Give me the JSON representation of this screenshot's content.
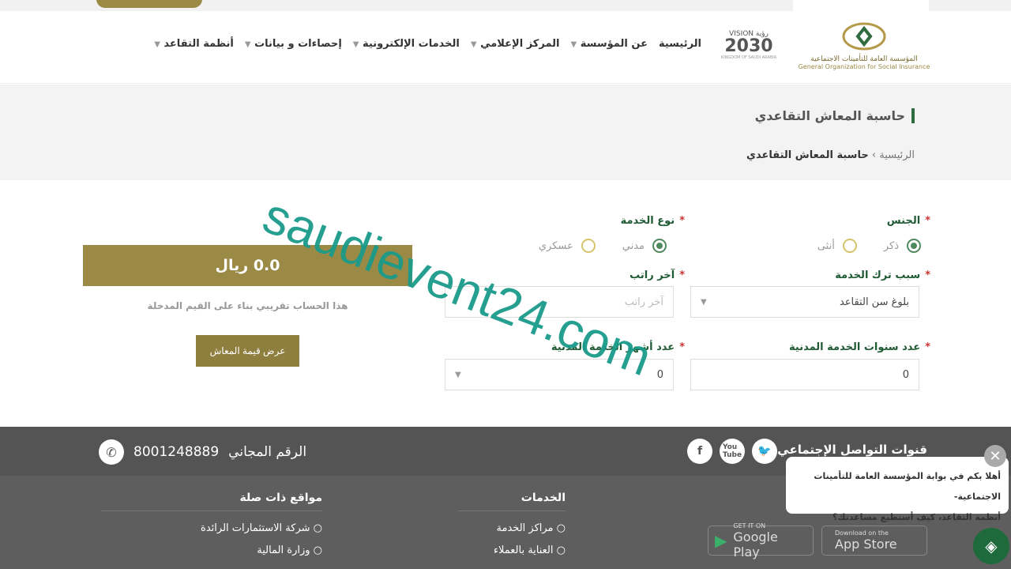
{
  "header": {
    "logo_ar": "المؤسسة العامة للتأمينات الاجتماعية",
    "logo_en": "General Organization for Social Insurance",
    "vision_label": "VISION رؤية",
    "vision_year": "2030",
    "vision_sub": "KINGDOM OF SAUDI ARABIA",
    "nav": [
      {
        "label": "الرئيسية",
        "dropdown": false
      },
      {
        "label": "عن المؤسسة",
        "dropdown": true
      },
      {
        "label": "المركز الإعلامي",
        "dropdown": true
      },
      {
        "label": "الخدمات الإلكترونية",
        "dropdown": true
      },
      {
        "label": "إحصاءات و بيانات",
        "dropdown": true
      },
      {
        "label": "أنظمة التقاعد",
        "dropdown": true
      }
    ]
  },
  "page": {
    "title": "حاسبة المعاش التقاعدي",
    "breadcrumb": [
      "الرئيسية",
      "حاسبة المعاش التقاعدي"
    ],
    "breadcrumb_sep": "›"
  },
  "form": {
    "gender": {
      "label": "الجنس",
      "options": [
        "ذكر",
        "أنثى"
      ],
      "selected": "ذكر"
    },
    "service_type": {
      "label": "نوع الخدمة",
      "options": [
        "مدني",
        "عسكري"
      ],
      "selected": "مدني"
    },
    "leave_reason": {
      "label": "سبب ترك الخدمة",
      "value": "بلوغ سن التقاعد"
    },
    "last_salary": {
      "label": "آخر راتب",
      "placeholder": "آخر راتب",
      "value": ""
    },
    "civil_years": {
      "label": "عدد سنوات الخدمة المدنية",
      "value": "0"
    },
    "civil_months": {
      "label": "عدد أشهر الخدمة المدنية",
      "value": "0"
    },
    "required_mark": "*"
  },
  "result": {
    "value": "0.0 ريال",
    "note": "هذا الحساب تقريبي بناء على القيم المدخلة",
    "button": "عرض قيمة المعاش"
  },
  "watermark": "saudievent24.com",
  "footer": {
    "social_title": "قنوات التواصل الإجتماعي",
    "social": [
      "twitter",
      "youtube",
      "facebook"
    ],
    "toll_free_label": "الرقم المجاني",
    "toll_free_number": "8001248889",
    "services_title": "الخدمات",
    "services": [
      "مراكز الخدمة",
      "العناية بالعملاء"
    ],
    "related_title": "مواقع ذات صلة",
    "related": [
      "شركة الاستثمارات الرائدة",
      "وزارة المالية"
    ],
    "google_play": {
      "small": "GET IT ON",
      "big": "Google Play"
    },
    "app_store": {
      "small": "Download on the",
      "big": "App Store"
    }
  },
  "chat": {
    "line1": "أهلا بكم في بوابة المؤسسة العامة للتأمينات الاجتماعية-",
    "line2": "أنظمة التقاعد، كيف أستطيع مساعدتك؟",
    "close": "✕"
  },
  "colors": {
    "gold": "#9a8a45",
    "green": "#1f5a34",
    "footer": "#545454"
  }
}
